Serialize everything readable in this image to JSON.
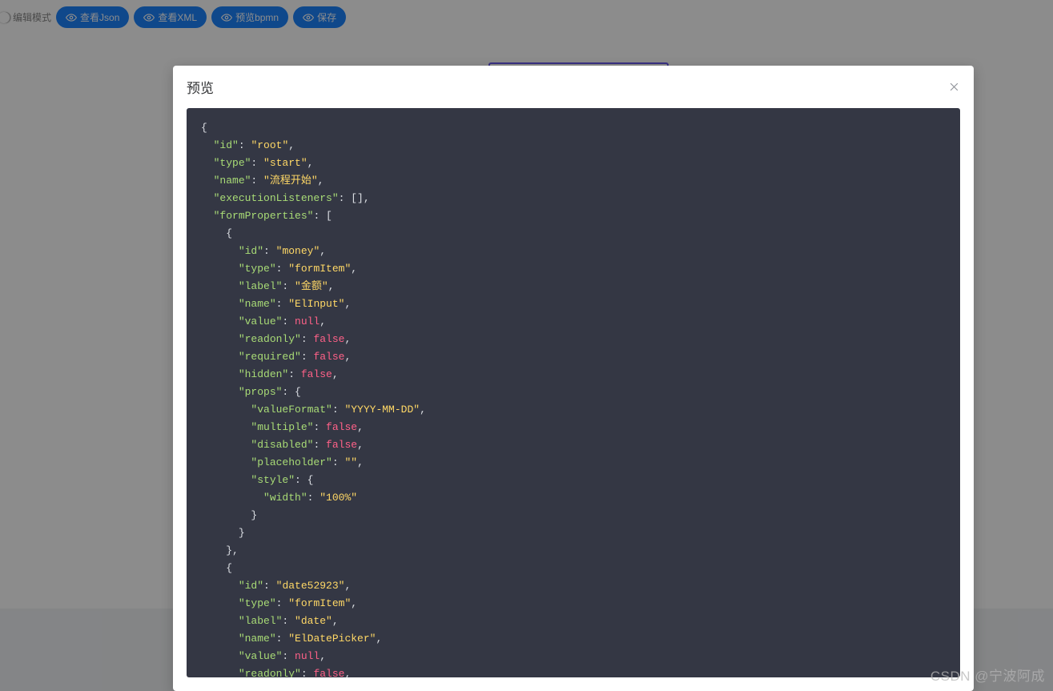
{
  "toolbar": {
    "edit_mode_label": "编辑模式",
    "view_json_label": "查看Json",
    "view_xml_label": "查看XML",
    "preview_bpmn_label": "预览bpmn",
    "save_label": "保存"
  },
  "dialog": {
    "title": "预览"
  },
  "code": {
    "lines": [
      {
        "i": 0,
        "t": "punc",
        "v": "{"
      },
      {
        "i": 1,
        "t": "kv",
        "k": "id",
        "vt": "str",
        "v": "root",
        "c": true
      },
      {
        "i": 1,
        "t": "kv",
        "k": "type",
        "vt": "str",
        "v": "start",
        "c": true
      },
      {
        "i": 1,
        "t": "kv",
        "k": "name",
        "vt": "str",
        "v": "流程开始",
        "c": true
      },
      {
        "i": 1,
        "t": "kv",
        "k": "executionListeners",
        "vt": "raw",
        "v": "[]",
        "c": true
      },
      {
        "i": 1,
        "t": "kv",
        "k": "formProperties",
        "vt": "raw",
        "v": "["
      },
      {
        "i": 2,
        "t": "punc",
        "v": "{"
      },
      {
        "i": 3,
        "t": "kv",
        "k": "id",
        "vt": "str",
        "v": "money",
        "c": true
      },
      {
        "i": 3,
        "t": "kv",
        "k": "type",
        "vt": "str",
        "v": "formItem",
        "c": true
      },
      {
        "i": 3,
        "t": "kv",
        "k": "label",
        "vt": "str",
        "v": "金额",
        "c": true
      },
      {
        "i": 3,
        "t": "kv",
        "k": "name",
        "vt": "str",
        "v": "ElInput",
        "c": true
      },
      {
        "i": 3,
        "t": "kv",
        "k": "value",
        "vt": "lit",
        "v": "null",
        "c": true
      },
      {
        "i": 3,
        "t": "kv",
        "k": "readonly",
        "vt": "lit",
        "v": "false",
        "c": true
      },
      {
        "i": 3,
        "t": "kv",
        "k": "required",
        "vt": "lit",
        "v": "false",
        "c": true
      },
      {
        "i": 3,
        "t": "kv",
        "k": "hidden",
        "vt": "lit",
        "v": "false",
        "c": true
      },
      {
        "i": 3,
        "t": "kv",
        "k": "props",
        "vt": "raw",
        "v": "{"
      },
      {
        "i": 4,
        "t": "kv",
        "k": "valueFormat",
        "vt": "str",
        "v": "YYYY-MM-DD",
        "c": true
      },
      {
        "i": 4,
        "t": "kv",
        "k": "multiple",
        "vt": "lit",
        "v": "false",
        "c": true
      },
      {
        "i": 4,
        "t": "kv",
        "k": "disabled",
        "vt": "lit",
        "v": "false",
        "c": true
      },
      {
        "i": 4,
        "t": "kv",
        "k": "placeholder",
        "vt": "str",
        "v": "",
        "c": true
      },
      {
        "i": 4,
        "t": "kv",
        "k": "style",
        "vt": "raw",
        "v": "{"
      },
      {
        "i": 5,
        "t": "kv",
        "k": "width",
        "vt": "str",
        "v": "100%"
      },
      {
        "i": 4,
        "t": "punc",
        "v": "}"
      },
      {
        "i": 3,
        "t": "punc",
        "v": "}"
      },
      {
        "i": 2,
        "t": "punc",
        "v": "},",
        "trail": true
      },
      {
        "i": 2,
        "t": "punc",
        "v": "{"
      },
      {
        "i": 3,
        "t": "kv",
        "k": "id",
        "vt": "str",
        "v": "date52923",
        "c": true
      },
      {
        "i": 3,
        "t": "kv",
        "k": "type",
        "vt": "str",
        "v": "formItem",
        "c": true
      },
      {
        "i": 3,
        "t": "kv",
        "k": "label",
        "vt": "str",
        "v": "date",
        "c": true
      },
      {
        "i": 3,
        "t": "kv",
        "k": "name",
        "vt": "str",
        "v": "ElDatePicker",
        "c": true
      },
      {
        "i": 3,
        "t": "kv",
        "k": "value",
        "vt": "lit",
        "v": "null",
        "c": true
      },
      {
        "i": 3,
        "t": "kv",
        "k": "readonly",
        "vt": "lit",
        "v": "false",
        "c": true
      }
    ]
  },
  "watermark": "CSDN @宁波阿成"
}
